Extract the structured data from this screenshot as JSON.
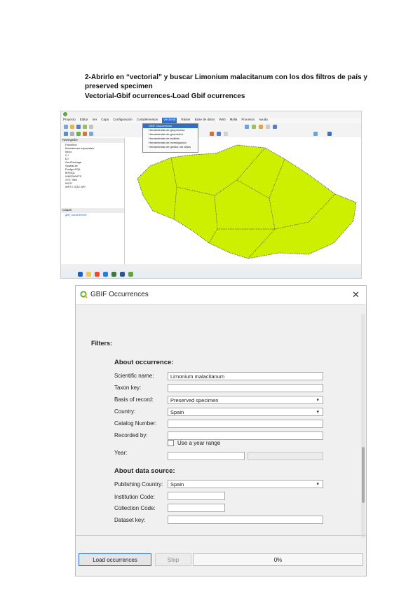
{
  "document": {
    "line1": "2-Abrirlo en “vectorial” y buscar Limonium malacitanum con los dos filtros de país y",
    "line2": "preserved specimen",
    "line3": "Vectorial-Gbif ocurrences-Load Gbif ocurrences"
  },
  "qgis": {
    "menu": [
      "Proyecto",
      "Editar",
      "Ver",
      "Capa",
      "Configuración",
      "Complementos",
      "Vectorial",
      "Ráster",
      "Base de datos",
      "Web",
      "Malla",
      "Procesos",
      "Ayuda"
    ],
    "active_menu_index": 6,
    "dropdown_items": [
      "GBIF Occurrences",
      "Herramientas de geoproceso",
      "Herramientas de geometría",
      "Herramientas de análisis",
      "Herramientas de investigación",
      "Herramientas de gestión de datos"
    ],
    "browser_title": "Navegador",
    "browser_items": [
      "Favoritos",
      "Marcadores espaciales",
      "Inicio",
      "C:\\",
      "D:\\",
      "GeoPackage",
      "SpatiaLite",
      "PostgreSQL",
      "MSSQL",
      "WMS/WMTS",
      "XYZ Tiles",
      "WCS",
      "WFS / OGC API"
    ],
    "layers_title": "Capas",
    "layers_items": [
      "gbif_occurrences"
    ],
    "region_fill": "#cdf000",
    "region_stroke": "#555555"
  },
  "dialog": {
    "title": "GBIF Occurrences",
    "close": "✕",
    "filters_label": "Filters:",
    "about_occurrence": "About occurrence:",
    "fields": [
      {
        "label": "Scientific name:",
        "value": "Limonium malacitanum",
        "type": "text"
      },
      {
        "label": "Taxon key:",
        "value": "",
        "type": "text"
      },
      {
        "label": "Basis of record:",
        "value": "Preserved specimen",
        "type": "combo"
      },
      {
        "label": "Country:",
        "value": "Spain",
        "type": "combo"
      },
      {
        "label": "Catalog Number:",
        "value": "",
        "type": "text"
      },
      {
        "label": "Recorded by:",
        "value": "",
        "type": "text"
      }
    ],
    "year_range_label": "Use a year range",
    "year_label": "Year:",
    "about_data_source": "About data source:",
    "source_fields": [
      {
        "label": "Publishing Country:",
        "value": "Spain",
        "type": "combo"
      },
      {
        "label": "Institution Code:",
        "value": "",
        "type": "text"
      },
      {
        "label": "Collection Code:",
        "value": "",
        "type": "text"
      },
      {
        "label": "Dataset key:",
        "value": "",
        "type": "text"
      }
    ],
    "load_button": "Load occurrences",
    "stop_button": "Stop",
    "progress": "0%",
    "accent": "#2a6fd1"
  }
}
